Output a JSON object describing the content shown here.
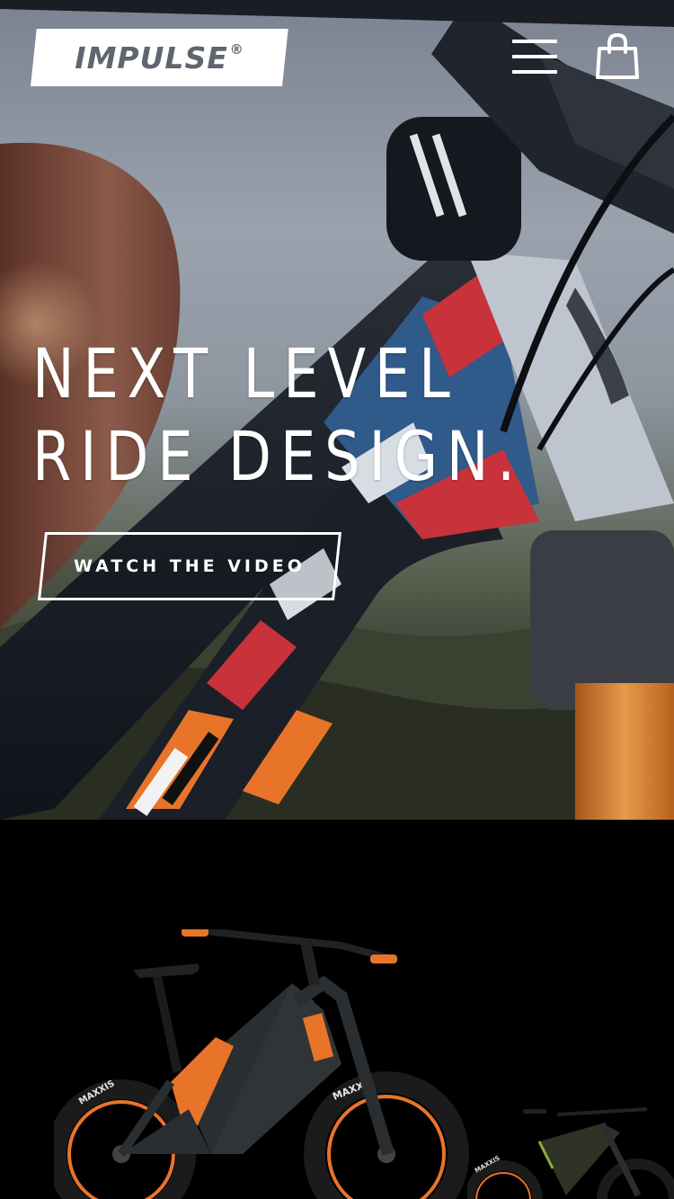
{
  "header": {
    "logo_text": "IMPULSE",
    "logo_mark": "®",
    "menu_icon": "hamburger-menu-icon",
    "cart_icon": "shopping-bag-icon"
  },
  "hero": {
    "headline_line1": "NEXT LEVEL",
    "headline_line2": "RIDE DESIGN.",
    "cta_label": "WATCH THE VIDEO",
    "image_alt": "Close-up of a mountain bike frame and headset"
  },
  "products": {
    "items": [
      {
        "name": "featured-bike",
        "tire_brand": "MAXXIS"
      },
      {
        "name": "second-bike",
        "tire_brand": "MAXXIS"
      }
    ]
  },
  "colors": {
    "text_primary": "#ffffff",
    "logo_text": "#5f6670",
    "background_dark": "#000000",
    "accent_orange": "#e8742a",
    "accent_red": "#c8323a"
  }
}
